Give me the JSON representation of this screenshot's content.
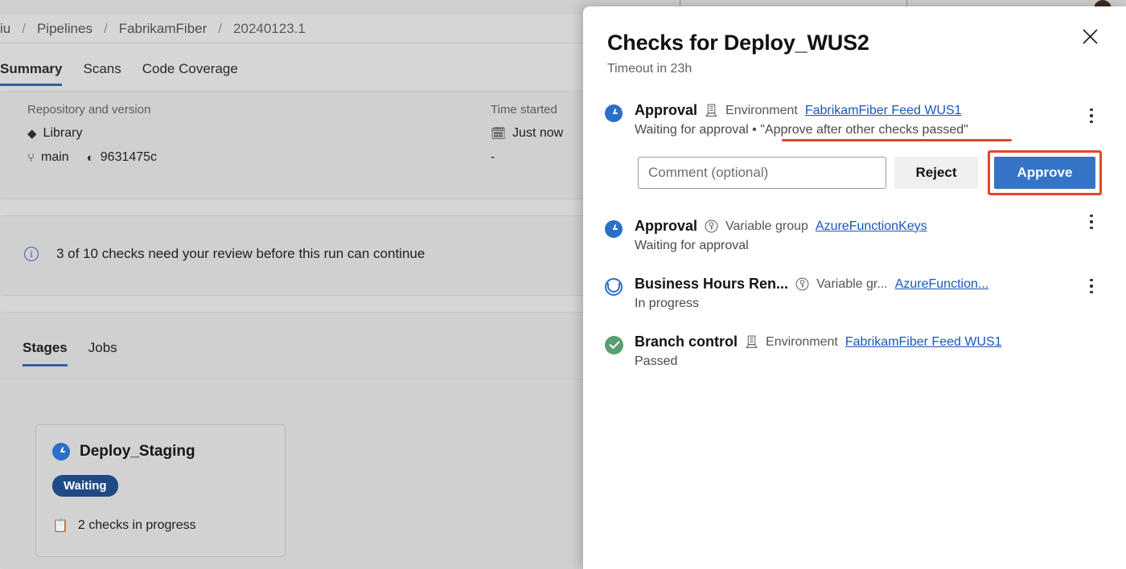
{
  "background": {
    "breadcrumb": {
      "items": [
        "iu",
        "Pipelines",
        "FabrikamFiber",
        "20240123.1"
      ],
      "separator": "/"
    },
    "tabs": [
      {
        "label": "Summary",
        "active": true
      },
      {
        "label": "Scans",
        "active": false
      },
      {
        "label": "Code Coverage",
        "active": false
      }
    ],
    "summary": {
      "repo_label": "Repository and version",
      "repo_name": "Library",
      "branch": "main",
      "commit": "9631475c",
      "time_started_label": "Time started",
      "time_started_value": "Just now",
      "elapsed_value": "-"
    },
    "banner": {
      "icon": "info-icon",
      "text": "3 of 10 checks need your review before this run can continue"
    },
    "sub_tabs": [
      {
        "label": "Stages",
        "active": true
      },
      {
        "label": "Jobs",
        "active": false
      }
    ],
    "stage_card": {
      "icon": "clock-icon",
      "title": "Deploy_Staging",
      "status_badge": "Waiting",
      "checks_icon": "checklist-icon",
      "checks_text": "2 checks in progress"
    }
  },
  "flyout": {
    "title": "Checks for Deploy_WUS2",
    "subtitle": "Timeout in 23h",
    "close_icon": "close-icon",
    "checks": [
      {
        "status_icon": "clock-icon",
        "name": "Approval",
        "resource_icon": "environment-icon",
        "resource_type": "Environment",
        "resource_link": "FabrikamFiber Feed WUS1",
        "state": "Waiting for approval",
        "separator": "•",
        "instruction": "\"Approve after other checks passed\"",
        "menu_icon": "kebab-menu-icon",
        "has_actions": true,
        "comment_placeholder": "Comment (optional)",
        "comment_value": "",
        "reject_label": "Reject",
        "approve_label": "Approve"
      },
      {
        "status_icon": "clock-icon",
        "name": "Approval",
        "resource_icon": "variable-group-icon",
        "resource_type": "Variable group",
        "resource_link": "AzureFunctionKeys",
        "state": "Waiting for approval",
        "menu_icon": "kebab-menu-icon",
        "has_actions": false
      },
      {
        "status_icon": "in-progress-icon",
        "name": "Business Hours Ren...",
        "resource_icon": "variable-group-icon",
        "resource_type": "Variable gr...",
        "resource_link": "AzureFunction...",
        "state": "In progress",
        "menu_icon": "kebab-menu-icon",
        "has_actions": false
      },
      {
        "status_icon": "passed-icon",
        "name": "Branch control",
        "resource_icon": "environment-icon",
        "resource_type": "Environment",
        "resource_link": "FabrikamFiber Feed WUS1",
        "state": "Passed",
        "menu_icon": null,
        "has_actions": false
      }
    ]
  },
  "annotations": {
    "highlight_color": "#e8432a",
    "underline_target": "instruction-text",
    "box_target": "approve-button"
  },
  "colors": {
    "accent_blue": "#3574c7",
    "link_blue": "#1a56b8",
    "passed_green": "#5a9e6f",
    "waiting_badge": "#1f4a86",
    "annotation_red": "#e8432a",
    "page_dim": "#d6d6d6"
  }
}
